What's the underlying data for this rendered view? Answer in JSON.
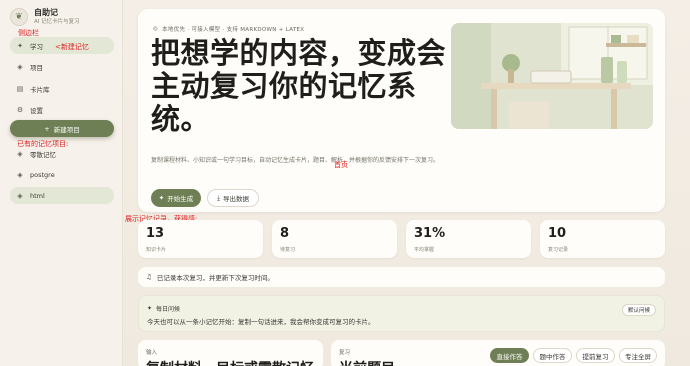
{
  "brand": {
    "title": "自助记",
    "subtitle": "AI 记忆卡片与复习",
    "logo_icon": "leaf-icon"
  },
  "annotations": {
    "sidebar": "侧边栏",
    "new_memory": "<新建记忆",
    "existing": "已有的记忆项目:",
    "home": "首页",
    "showcase": "展示记忆记录，获得感:"
  },
  "nav": [
    {
      "label": "学习",
      "icon": "sparkle-icon",
      "active": true
    },
    {
      "label": "项目",
      "icon": "layers-icon",
      "active": false
    },
    {
      "label": "卡片库",
      "icon": "book-icon",
      "active": false
    },
    {
      "label": "设置",
      "icon": "gear-icon",
      "active": false
    }
  ],
  "new_project_label": "新建项目",
  "projects": [
    {
      "label": "零散记忆",
      "icon": "layers-icon",
      "active": false
    },
    {
      "label": "postgre",
      "icon": "layers-icon",
      "active": false
    },
    {
      "label": "html",
      "icon": "layers-icon",
      "active": true
    }
  ],
  "hero": {
    "eyebrow": "本地优先 · 可接入模型 · 支持 MARKDOWN + LATEX",
    "headline": "把想学的内容，变成会主动复习你的记忆系统。",
    "description": "复制课程材料、小知识或一句学习目标，自动记忆生成卡片，题目、解析，并根据你的反馈安排下一次复习。",
    "primary_btn": "开始生成",
    "secondary_btn": "导出数据"
  },
  "stats": [
    {
      "value": "13",
      "label": "知识卡片"
    },
    {
      "value": "8",
      "label": "待复习"
    },
    {
      "value": "31%",
      "label": "平均掌握"
    },
    {
      "value": "10",
      "label": "复习记录"
    }
  ],
  "notice": "已记录本次复习，并更新下次复习时间。",
  "daily": {
    "title": "每日问候",
    "text": "今天也可以从一条小记忆开始：复制一句话进来，我会帮你变成可复习的卡片。",
    "button": "默认问候"
  },
  "input_panel": {
    "label": "输入",
    "big": "复制材料，目标或零散记忆"
  },
  "review_panel": {
    "label": "复习",
    "big": "当前题目"
  },
  "modes": [
    "直接作答",
    "题中作答",
    "提前复习",
    "专注全屏"
  ],
  "colors": {
    "accent": "#6f7f55",
    "annotation": "#e02020"
  }
}
